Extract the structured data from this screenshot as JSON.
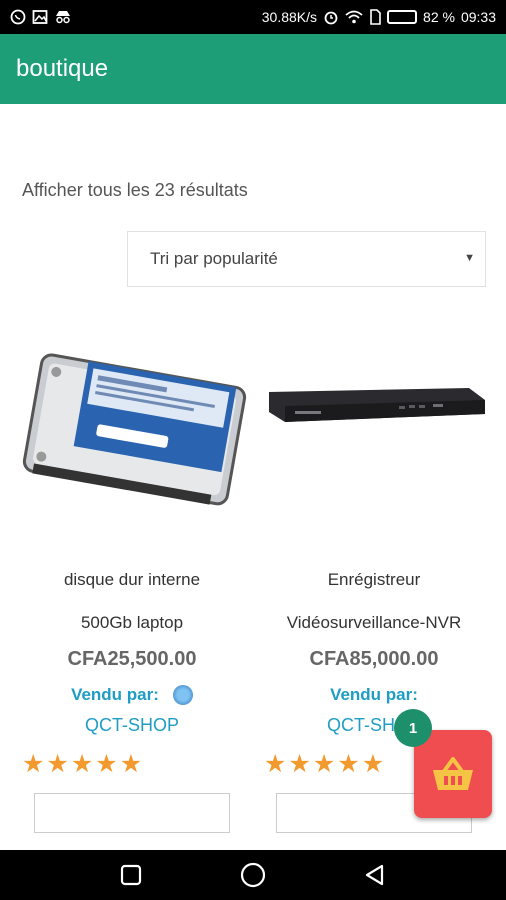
{
  "status_bar": {
    "network_speed": "30.88K/s",
    "battery_percent": "82 %",
    "time": "09:33",
    "icons": [
      "whatsapp-icon",
      "image-icon",
      "incognito-icon",
      "alarm-icon",
      "wifi-icon",
      "sim-icon",
      "battery-icon"
    ]
  },
  "app_bar": {
    "title": "boutique",
    "color": "#1d9e77"
  },
  "shop": {
    "result_count": "Afficher tous les 23 résultats",
    "sort": {
      "selected": "Tri par popularité"
    }
  },
  "products": [
    {
      "name_line1": "disque dur interne",
      "name_line2": "500Gb laptop",
      "price": "CFA25,500.00",
      "vendor_label": "Vendu par:",
      "vendor_name": "QCT-SHOP",
      "rating": 5,
      "image": "hard-drive-image"
    },
    {
      "name_line1": "Enrégistreur",
      "name_line2": "Vidéosurveillance-NVR",
      "price": "CFA85,000.00",
      "vendor_label": "Vendu par:",
      "vendor_name": "QCT-SHOP",
      "rating": 5,
      "image": "nvr-recorder-image"
    }
  ],
  "cart": {
    "count": "1",
    "color": "#ef4d4f",
    "badge_color": "#1d8f6b"
  },
  "colors": {
    "vendor": "#1f9dc4",
    "star": "#f29a2e"
  }
}
